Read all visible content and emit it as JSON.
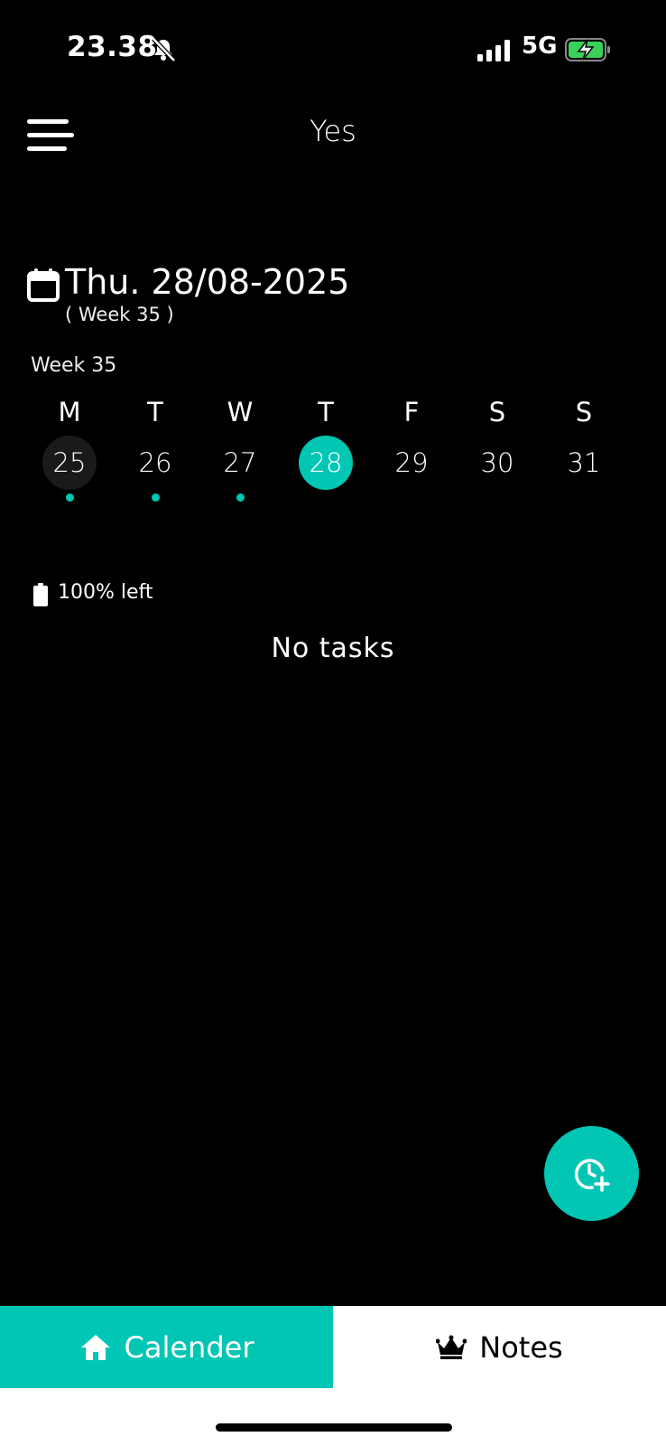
{
  "status_bar": {
    "time": "23.38",
    "network": "5G"
  },
  "header": {
    "title": "Yes"
  },
  "date_heading": {
    "title": "Thu. 28/08-2025",
    "subtitle": "( Week 35 )"
  },
  "week": {
    "label": "Week 35",
    "days": [
      {
        "letter": "M",
        "num": "25",
        "has_dot": true,
        "state": "today-ghost"
      },
      {
        "letter": "T",
        "num": "26",
        "has_dot": true,
        "state": ""
      },
      {
        "letter": "W",
        "num": "27",
        "has_dot": true,
        "state": ""
      },
      {
        "letter": "T",
        "num": "28",
        "has_dot": false,
        "state": "selected"
      },
      {
        "letter": "F",
        "num": "29",
        "has_dot": false,
        "state": ""
      },
      {
        "letter": "S",
        "num": "30",
        "has_dot": false,
        "state": ""
      },
      {
        "letter": "S",
        "num": "31",
        "has_dot": false,
        "state": ""
      }
    ]
  },
  "remaining": {
    "text": "100% left"
  },
  "tasks": {
    "empty_text": "No tasks"
  },
  "fab": {
    "icon": "clock-plus-icon"
  },
  "bottom_nav": {
    "calendar_label": "Calender",
    "notes_label": "Notes"
  },
  "colors": {
    "accent": "#00c6b3",
    "background": "#000000"
  }
}
